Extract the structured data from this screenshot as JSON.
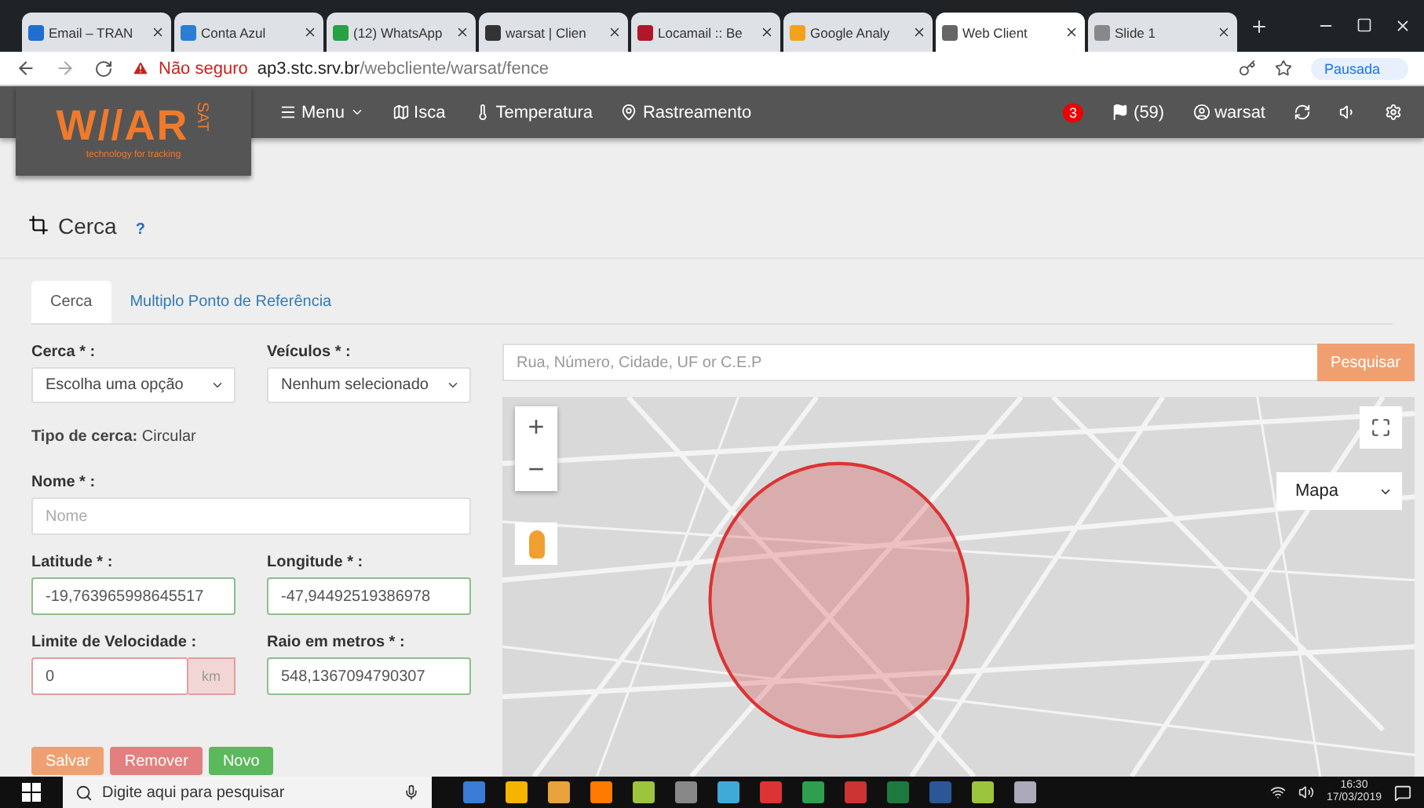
{
  "browser": {
    "tabs": [
      {
        "title": "Email – TRAN",
        "selected": false,
        "color": "#1e6fd0"
      },
      {
        "title": "Conta Azul",
        "selected": false,
        "color": "#2a7fd4"
      },
      {
        "title": "(12) WhatsApp",
        "selected": false,
        "color": "#25a244"
      },
      {
        "title": "warsat | Clien",
        "selected": false,
        "color": "#333333"
      },
      {
        "title": "Locamail :: Be",
        "selected": false,
        "color": "#b0182a"
      },
      {
        "title": "Google Analy",
        "selected": false,
        "color": "#f2a21b"
      },
      {
        "title": "Web Client",
        "selected": true,
        "color": "#666666"
      },
      {
        "title": "Slide 1",
        "selected": false,
        "color": "#888888"
      }
    ],
    "security": "Não seguro",
    "url_host": "ap3.stc.srv.br",
    "url_path": "/webcliente/warsat/fence",
    "profile": "Pausada"
  },
  "app": {
    "logo": "W//AR",
    "logo_suffix": "SAT",
    "tagline": "technology for tracking",
    "nav": [
      {
        "label": "Menu",
        "kind": "menu"
      },
      {
        "label": "Isca",
        "kind": "map"
      },
      {
        "label": "Temperatura",
        "kind": "thermo"
      },
      {
        "label": "Rastreamento",
        "kind": "pin"
      }
    ],
    "alerts": "3",
    "flags": "(59)",
    "user": "warsat"
  },
  "page": {
    "title": "Cerca",
    "help": "?"
  },
  "tabs": [
    {
      "label": "Cerca",
      "selected": true
    },
    {
      "label": "Multiplo Ponto de Referência",
      "selected": false
    }
  ],
  "form": {
    "cerca": {
      "label": "Cerca * :",
      "value": "Escolha uma opção"
    },
    "veiculos": {
      "label": "Veículos * :",
      "value": "Nenhum selecionado"
    },
    "tipo_label": "Tipo de cerca:",
    "tipo_value": "Circular",
    "nome": {
      "label": "Nome * :",
      "placeholder": "Nome"
    },
    "latitude": {
      "label": "Latitude * :",
      "value": "-19,763965998645517",
      "valid": true
    },
    "longitude": {
      "label": "Longitude * :",
      "value": "-47,94492519386978",
      "valid": true
    },
    "limite": {
      "label": "Limite de Velocidade :",
      "value": "0",
      "addon": "km",
      "valid": false
    },
    "raio": {
      "label": "Raio em metros * :",
      "value": "548,1367094790307",
      "valid": true
    },
    "buttons": [
      {
        "label": "Salvar",
        "kind": "save"
      },
      {
        "label": "Remover",
        "kind": "remove"
      },
      {
        "label": "Novo",
        "kind": "new"
      }
    ]
  },
  "map": {
    "search_placeholder": "Rua, Número, Cidade, UF or C.E.P",
    "search_button": "Pesquisar",
    "map_type": "Mapa",
    "zoom_in": "+",
    "zoom_out": "−"
  },
  "taskbar": {
    "search_placeholder": "Digite aqui para pesquisar",
    "time": "16:30",
    "date": "17/03/2019"
  }
}
